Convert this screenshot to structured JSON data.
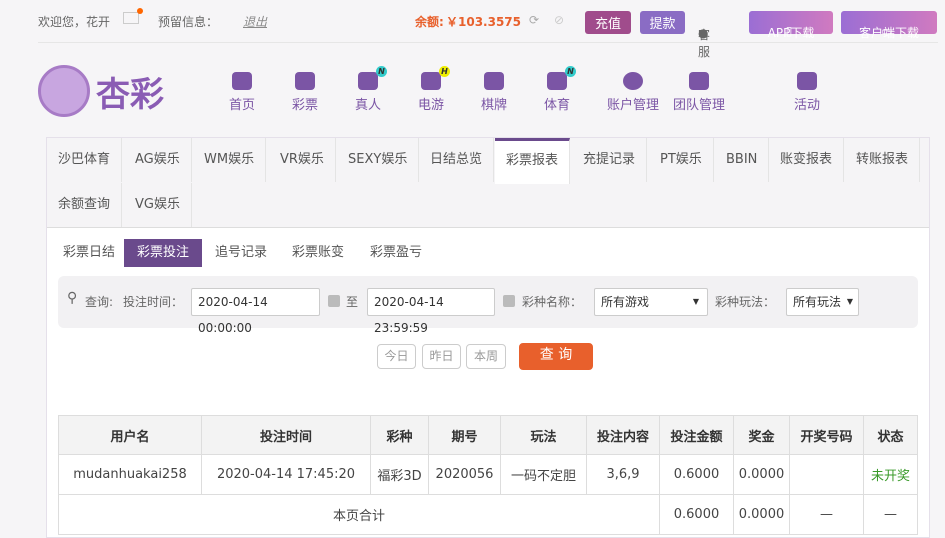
{
  "topbar": {
    "welcome": "欢迎您，花开",
    "reserve": "预留信息：",
    "logout": "退出",
    "balance_label": "余额:",
    "balance": "￥103.3575",
    "recharge": "充值",
    "withdraw": "提款",
    "service": "客服",
    "app_download": "APP下载",
    "client_download": "客户端下载"
  },
  "logo": "杏彩",
  "nav": [
    {
      "label": "首页"
    },
    {
      "label": "彩票"
    },
    {
      "label": "真人",
      "badge": "N"
    },
    {
      "label": "电游",
      "badge": "H"
    },
    {
      "label": "棋牌"
    },
    {
      "label": "体育",
      "badge": "N"
    },
    {
      "label": "账户管理"
    },
    {
      "label": "团队管理"
    },
    {
      "label": "活动"
    }
  ],
  "tabs": [
    "沙巴体育",
    "AG娱乐",
    "WM娱乐",
    "VR娱乐",
    "SEXY娱乐",
    "日结总览",
    "彩票报表",
    "充提记录",
    "PT娱乐",
    "BBIN",
    "账变报表",
    "转账报表",
    "余额查询",
    "VG娱乐"
  ],
  "subtabs": [
    "彩票日结",
    "彩票投注",
    "追号记录",
    "彩票账变",
    "彩票盈亏"
  ],
  "search": {
    "label": "查询:",
    "time_label": "投注时间：",
    "start": "2020-04-14 00:00:00",
    "to": "至",
    "end": "2020-04-14 23:59:59",
    "game_label": "彩种名称：",
    "game": "所有游戏",
    "play_label": "彩种玩法：",
    "play": "所有玩法",
    "today": "今日",
    "yesterday": "昨日",
    "week": "本周",
    "query": "查 询"
  },
  "table": {
    "headers": [
      "用户名",
      "投注时间",
      "彩种",
      "期号",
      "玩法",
      "投注内容",
      "投注金额",
      "奖金",
      "开奖号码",
      "状态"
    ],
    "row": [
      "mudanhuakai258",
      "2020-04-14 17:45:20",
      "福彩3D",
      "2020056",
      "一码不定胆",
      "3,6,9",
      "0.6000",
      "0.0000",
      "",
      "未开奖"
    ],
    "total_label": "本页合计",
    "total_amount": "0.6000",
    "total_bonus": "0.0000",
    "total_num": "—",
    "total_status": "—"
  }
}
